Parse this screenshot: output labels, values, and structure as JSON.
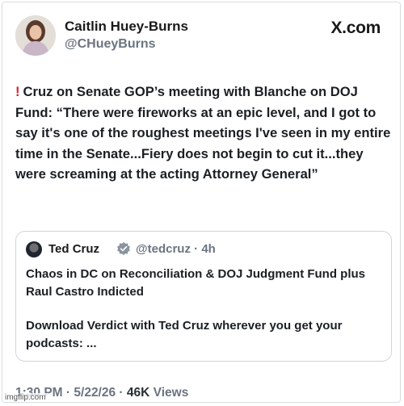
{
  "author": {
    "name": "Caitlin Huey-Burns",
    "handle": "@CHueyBurns"
  },
  "brand": "X.com",
  "tweet": {
    "marker": "!",
    "text": "Cruz on Senate GOP’s meeting with Blanche on DOJ Fund: “There were fireworks at an epic level, and I got to say it's one of the roughest meetings I've seen in my entire time in the Senate...Fiery does not begin to cut it...they were screaming at the acting Attorney General”"
  },
  "quoted": {
    "name": "Ted Cruz",
    "handle": "@tedcruz",
    "separator": "·",
    "age": "4h",
    "body1": "Chaos in DC on Reconciliation & DOJ Judgment Fund plus Raul Castro Indicted",
    "body2": "Download Verdict with Ted Cruz wherever you get your podcasts: ..."
  },
  "footer": {
    "time": "1:30 PM",
    "date": "5/22/26",
    "separator": "·",
    "views_count": "46K",
    "views_label": "Views"
  },
  "watermark": "imgflip.com",
  "colors": {
    "alert_red": "#d81e2b",
    "verified_badge": "#8a949e",
    "muted_text": "#6b7480"
  }
}
